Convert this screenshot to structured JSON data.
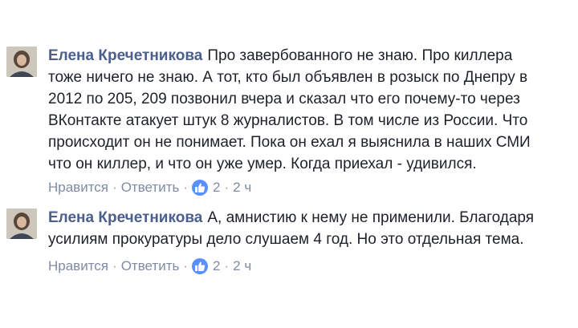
{
  "comments": [
    {
      "author": "Елена Кречетникова",
      "lines": [
        "Про завербованного не знаю. Про киллера",
        "тоже ничего не знаю. А тот, кто был объявлен в розыск по Днепру в",
        "2012 по 205, 209 позвонил вчера и сказал что его почему-то через",
        "ВКонтакте атакует штук 8 журналистов. В том числе из России. Что",
        "происходит он не понимает. Пока он ехал я выяснила в наших СМИ",
        "что он киллер, и что он уже умер. Когда приехал - удивился."
      ],
      "like_label": "Нравится",
      "reply_label": "Ответить",
      "likes": "2",
      "time": "2 ч"
    },
    {
      "author": "Елена Кречетникова",
      "lines": [
        "А, амнистию к нему не применили. Благодаря",
        "усилиям прокуратуры дело слушаем 4 год. Но это отдельная тема."
      ],
      "like_label": "Нравится",
      "reply_label": "Ответить",
      "likes": "2",
      "time": "2 ч"
    }
  ],
  "separator": "·",
  "icons": {
    "like": "thumbs-up-icon",
    "avatar": "user-avatar"
  },
  "colors": {
    "author": "#4b5f8c",
    "link": "#7f8ba4",
    "like_badge": "#5890ff"
  }
}
